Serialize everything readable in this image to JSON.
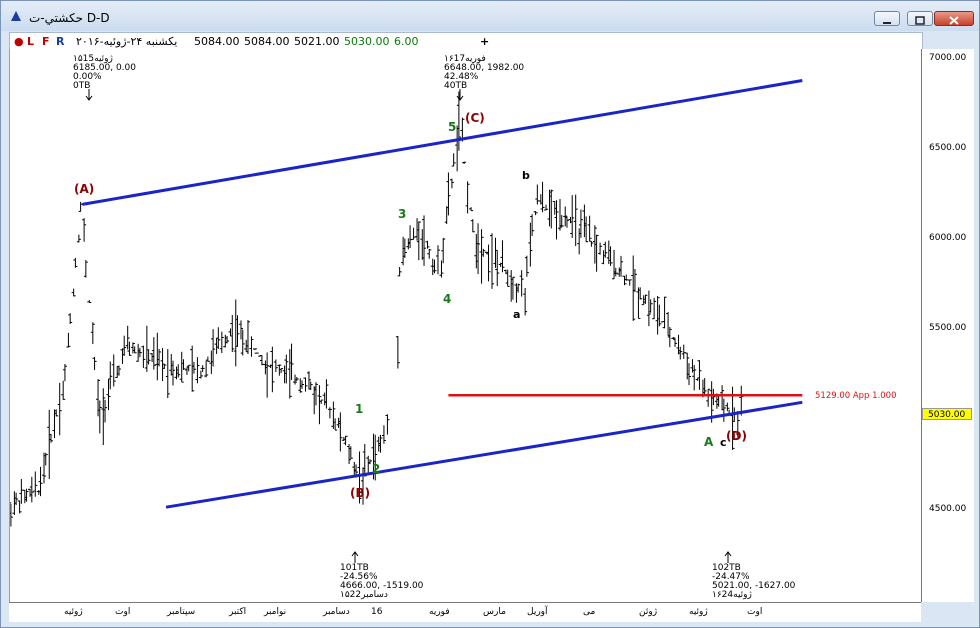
{
  "window": {
    "title": "حکشتي-ت D-D",
    "buttons": [
      "minimize",
      "restore",
      "close"
    ]
  },
  "infobar": {
    "toggles": [
      {
        "label": "L",
        "color": "#c00000"
      },
      {
        "label": "F",
        "color": "#c00000"
      },
      {
        "label": "R",
        "color": "#1a3d9e"
      }
    ],
    "date": "یکشنبه ۲۴-ژوئیه-۲۰۱۶",
    "open": "5084.00",
    "high": "5084.00",
    "low": "5021.00",
    "close": "5030.00",
    "change": "6.00",
    "plus": "+"
  },
  "price_axis": {
    "ticks": [
      "7000.00",
      "6500.00",
      "6000.00",
      "5500.00",
      "5000.00",
      "4500.00"
    ],
    "current_price": "5030.00"
  },
  "time_axis": {
    "ticks": [
      "ژوئیه",
      "اوت",
      "سپتامبر",
      "اکتبر",
      "نوامبر",
      "دسامبر",
      "16",
      "فوریه",
      "مارس",
      "آوریل",
      "می",
      "ژوئن",
      "ژوئیه",
      "اوت"
    ]
  },
  "annotations": {
    "pivot_a": [
      "۱۵ژوئیه15",
      "6185.00, 0.00",
      "0.00%",
      "0TB"
    ],
    "pivot_c": [
      "۱۶فوریه17",
      "6648.00, 1982.00",
      "42.48%",
      "40TB"
    ],
    "pivot_b": [
      "101TB",
      "-24.56%",
      "4666.00, -1519.00",
      "۱۵دسامبر22"
    ],
    "pivot_d": [
      "102TB",
      "-24.47%",
      "5021.00, -1627.00",
      "۱۶ژوئیه24"
    ],
    "horizontal_line_label": "5129.00 App 1.000"
  },
  "wave_labels": {
    "A_cap": "(A)",
    "B_cap": "(B)",
    "C_cap": "(C)",
    "D_cap": "(D)",
    "w1": "1",
    "w2": "2",
    "w3": "3",
    "w4": "4",
    "w5": "5",
    "a": "a",
    "b": "b",
    "c": "c",
    "A": "A"
  },
  "colors": {
    "channel": "#1a24c8",
    "horizontal": "#e01010",
    "wave_green": "#1a7a1a",
    "wave_maroon": "#8b0000",
    "bars": "#000000"
  },
  "chart_data": {
    "type": "ohlc",
    "ylim": [
      4300,
      7050
    ],
    "y_ticks": [
      4500,
      5000,
      5500,
      6000,
      6500,
      7000
    ],
    "x_range": [
      "2015-07",
      "2016-08"
    ],
    "current_price": 5030,
    "horizontal_line": {
      "value": 5129,
      "label": "5129.00 App 1.000"
    },
    "channel_lines": [
      {
        "name": "upper",
        "points": [
          [
            "2015-07-15",
            6185
          ],
          [
            "2016-08-31",
            6870
          ]
        ]
      },
      {
        "name": "lower",
        "points": [
          [
            "2015-09-01",
            4510
          ],
          [
            "2016-08-31",
            5090
          ]
        ]
      }
    ],
    "pivots": [
      {
        "label": "(A)",
        "date": "2015-07-15",
        "price": 6185
      },
      {
        "label": "(B)",
        "date": "2015-12-22",
        "price": 4666
      },
      {
        "label": "(C)",
        "date": "2016-02-17",
        "price": 6648
      },
      {
        "label": "(D)",
        "date": "2016-07-24",
        "price": 5021
      }
    ]
  }
}
